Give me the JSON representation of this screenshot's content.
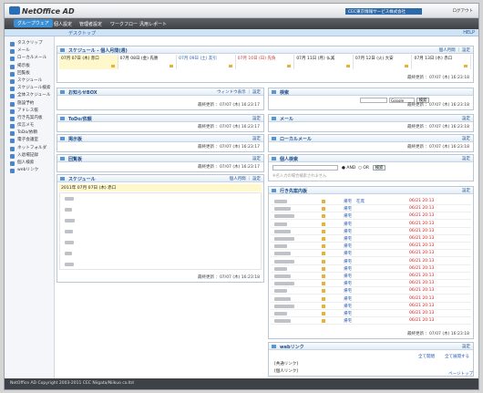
{
  "header": {
    "logo": "NetOffice AD",
    "org": "CEC東京情報サービス株式会社",
    "links": "ログアウト"
  },
  "nav": [
    "グループウェア",
    "個人設定",
    "管理者設定",
    "ワークフロー",
    "汎用レポート"
  ],
  "subbar": {
    "title": "デスクトップ",
    "help": "HELP"
  },
  "sidebar": [
    "タスクリップ",
    "メール",
    "ローカルメール",
    "掲示板",
    "回覧板",
    "スケジュール",
    "スケジュール検索",
    "全体スケジュール",
    "施設予約",
    "アドレス帳",
    "行き先案内板",
    "伝言メモ",
    "ToDo/依頼",
    "電子会議室",
    "ネットフォルダ",
    "入退場記録",
    "個人検索",
    "webリンク"
  ],
  "sched": {
    "title": "スケジュール - 個人月間(週)",
    "tools": "個人月間 ｜ 設定",
    "days": [
      "07月 07日 (木) 赤口",
      "07月 08日 (金) 先勝",
      "07月 09日 (土) 友引",
      "07月 10日 (日) 先負",
      "07月 11日 (月) 仏滅",
      "07月 12日 (火) 大安",
      "07月 13日 (水) 赤口"
    ],
    "updated": "最終更新 ：07/07 (木) 16:23:18"
  },
  "notice": {
    "title": "お知らせBOX",
    "tools": "ウィンドウ表示 ｜ 設定",
    "updated": "最終更新 ：07/07 (木) 16:23:17"
  },
  "todo": {
    "title": "ToDo/依頼",
    "tools": "設定",
    "updated": "最終更新 ：07/07 (木) 16:23:17"
  },
  "board": {
    "title": "掲示板",
    "tools": "設定",
    "updated": "最終更新 ：07/07 (木) 16:23:17"
  },
  "circ": {
    "title": "回覧板",
    "tools": "設定",
    "updated": "最終更新 ：07/07 (木) 16:23:17"
  },
  "sched2": {
    "title": "スケジュール",
    "tools": "個人月間 ｜ 設定",
    "date": "2011年 07月 07日 (木) 赤口",
    "updated": "最終更新 ：07/07 (木) 16:23:18"
  },
  "search": {
    "title": "検索",
    "engine": "Google",
    "btn": "検索",
    "updated": "最終更新 ：07/07 (木) 16:23:18"
  },
  "mail": {
    "title": "メール",
    "tools": "設定",
    "updated": "最終更新 ：07/07 (木) 16:23:18"
  },
  "lmail": {
    "title": "ローカルメール",
    "tools": "設定",
    "updated": "最終更新 ：07/07 (木) 16:23:18"
  },
  "psearch": {
    "title": "個人検索",
    "tools": "設定",
    "placeholder": "※名入力の場合検索されません",
    "and": "AND",
    "or": "OR",
    "btn": "検索"
  },
  "dest": {
    "title": "行き先案内板",
    "tools": "設定",
    "status": "帰宅",
    "status0": "在席",
    "time": "06/21 20:13",
    "updated": "最終更新 ：07/07 (木) 16:23:18"
  },
  "weblink": {
    "title": "webリンク",
    "tools": "設定",
    "links": [
      "全て開閉",
      "全て展開する"
    ],
    "items": [
      "[共通リンク]",
      "[個人リンク]"
    ],
    "pagetop": "ページトップ"
  },
  "footer": {
    "copy": "NetOffice AD Copyright 2003-2011 CEC Niigata/Niikuo co.ltd"
  }
}
